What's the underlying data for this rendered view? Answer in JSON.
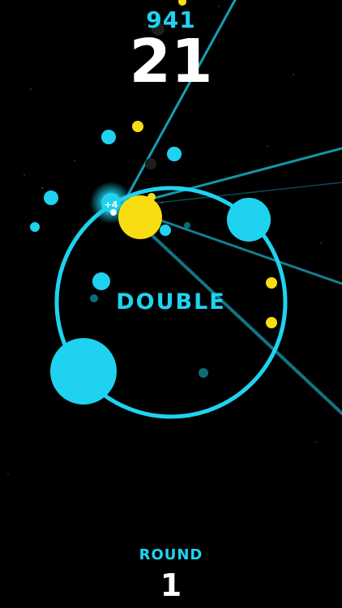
{
  "hud": {
    "best_score": "941",
    "score": "21"
  },
  "game": {
    "mode_label": "DOUBLE",
    "bonus_popup": "+4"
  },
  "round": {
    "label": "ROUND",
    "value": "1"
  },
  "colors": {
    "background": "#000000",
    "cyan": "#1fd3f0",
    "yellow": "#f7dd12",
    "white": "#ffffff"
  }
}
